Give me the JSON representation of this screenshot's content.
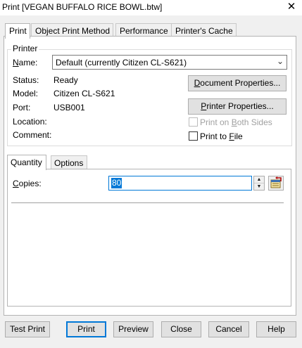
{
  "window": {
    "title": "Print [VEGAN BUFFALO RICE BOWL.btw]",
    "close_glyph": "✕"
  },
  "tabs": [
    {
      "label": "Print",
      "active": true
    },
    {
      "label": "Object Print Method",
      "active": false
    },
    {
      "label": "Performance",
      "active": false
    },
    {
      "label": "Printer's Cache",
      "active": false
    }
  ],
  "printer": {
    "group_title": "Printer",
    "name_label_pre": "",
    "name_label_key": "N",
    "name_label_post": "ame:",
    "name_value": "Default (currently Citizen CL-S621)",
    "status_label": "Status:",
    "status_value": "Ready",
    "model_label": "Model:",
    "model_value": "Citizen CL-S621",
    "port_label": "Port:",
    "port_value": "USB001",
    "location_label": "Location:",
    "comment_label": "Comment:",
    "doc_props_pre": "",
    "doc_props_key": "D",
    "doc_props_post": "ocument Properties...",
    "printer_props_pre": "",
    "printer_props_key": "P",
    "printer_props_post": "rinter Properties...",
    "both_sides_pre": "Print on ",
    "both_sides_key": "B",
    "both_sides_post": "oth Sides",
    "to_file_pre": "Print to ",
    "to_file_key": "F",
    "to_file_post": "ile",
    "both_sides_checked": false,
    "to_file_checked": false
  },
  "subtabs": [
    {
      "label": "Quantity",
      "active": true
    },
    {
      "label": "Options",
      "active": false
    }
  ],
  "quantity": {
    "copies_label_pre": "",
    "copies_label_key": "C",
    "copies_label_post": "opies:",
    "copies_value": "80"
  },
  "buttons": {
    "test_print": "Test Print",
    "print": "Print",
    "preview": "Preview",
    "close": "Close",
    "cancel": "Cancel",
    "help": "Help"
  },
  "icons": {
    "combo_arrow": "chevron-down-icon",
    "spin_up": "spin-up-icon",
    "spin_down": "spin-down-icon",
    "picker": "database-picker-icon"
  }
}
